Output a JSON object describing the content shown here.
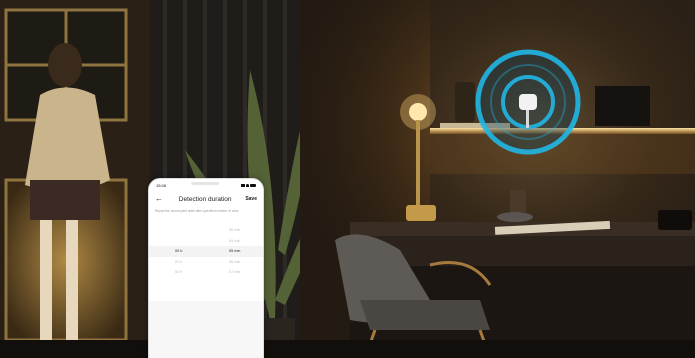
{
  "phone": {
    "status_time": "15:08",
    "title": "Detection duration",
    "save_label": "Save",
    "back_icon": "←",
    "description": "Report the unoccupied state after specified number of mins",
    "picker_rows": [
      {
        "hours": "",
        "minutes": "00 min"
      },
      {
        "hours": "",
        "minutes": "04 min"
      },
      {
        "hours": "00 h",
        "minutes": "05 min"
      },
      {
        "hours": "01 h",
        "minutes": "06 min"
      },
      {
        "hours": "02 h",
        "minutes": "07 min"
      }
    ],
    "selected_index": 2
  },
  "colors": {
    "accent_glow": "#21b7e6",
    "lamp_light": "#ffd37a",
    "phone_bg": "#ffffff"
  }
}
